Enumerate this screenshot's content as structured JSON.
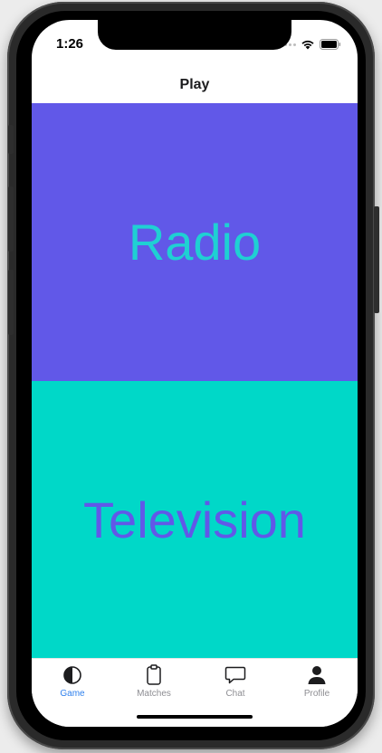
{
  "status_bar": {
    "time": "1:26"
  },
  "nav": {
    "title": "Play"
  },
  "options": [
    {
      "label": "Radio",
      "background": "#6158E8",
      "text_color": "#1FD0D3"
    },
    {
      "label": "Television",
      "background": "#00D8C8",
      "text_color": "#6158E8"
    }
  ],
  "tabs": [
    {
      "label": "Game",
      "icon": "half-circle-icon",
      "active": true
    },
    {
      "label": "Matches",
      "icon": "clipboard-icon",
      "active": false
    },
    {
      "label": "Chat",
      "icon": "chat-bubble-icon",
      "active": false
    },
    {
      "label": "Profile",
      "icon": "person-icon",
      "active": false
    }
  ],
  "colors": {
    "accent": "#2F80ED",
    "inactive": "#8E8E93"
  }
}
